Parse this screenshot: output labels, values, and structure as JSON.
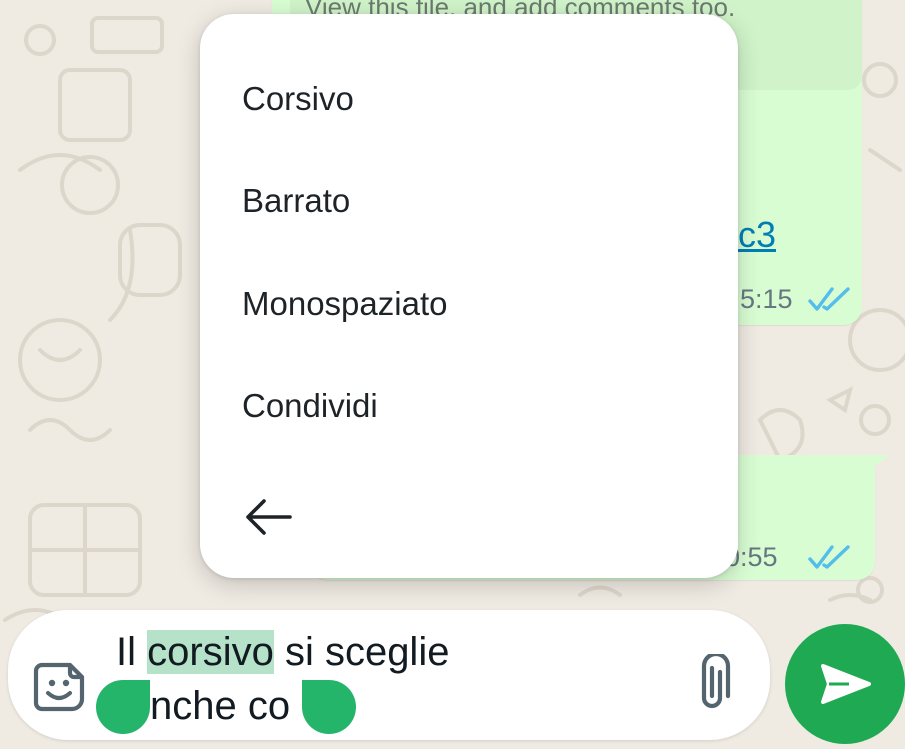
{
  "chat": {
    "preview_description": "View this file, and add comments too.",
    "link_fragment": "c3",
    "message1_time": "5:15",
    "message2_time": "0:55",
    "read_status_color": "#53bdeb"
  },
  "context_menu": {
    "items": [
      {
        "label": "Corsivo"
      },
      {
        "label": "Barrato"
      },
      {
        "label": "Monospaziato"
      },
      {
        "label": "Condividi"
      }
    ],
    "back_icon": "arrow-left-icon"
  },
  "composer": {
    "line1_before": "Il ",
    "line1_selected": "corsivo",
    "line1_after": " si sceglie",
    "line2": "nche co",
    "sticker_icon": "sticker-icon",
    "attach_icon": "paperclip-icon",
    "send_icon": "send-icon"
  },
  "colors": {
    "accent": "#1ea952",
    "bubble": "#d9fdd3",
    "background": "#efeae2"
  }
}
